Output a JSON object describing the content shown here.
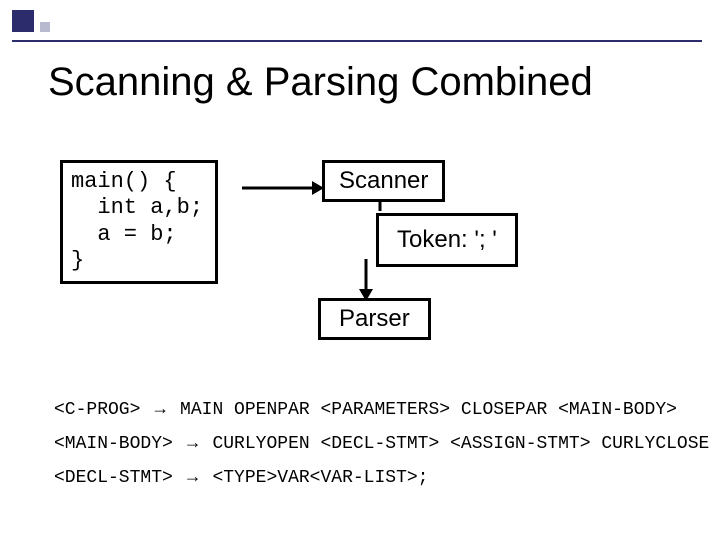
{
  "title": "Scanning & Parsing Combined",
  "code": "main() {\n  int a,b;\n  a = b;\n}",
  "boxes": {
    "scanner": "Scanner",
    "token": "Token: '; '",
    "parser": "Parser"
  },
  "grammar": {
    "line1": {
      "lhs": "<C-PROG>",
      "rhs": "MAIN OPENPAR <PARAMETERS> CLOSEPAR <MAIN-BODY>"
    },
    "line2": {
      "lhs": "<MAIN-BODY>",
      "rhs": "CURLYOPEN <DECL-STMT> <ASSIGN-STMT> CURLYCLOSE"
    },
    "line3": {
      "lhs": "<DECL-STMT>",
      "rhs": "<TYPE>VAR<VAR-LIST>;"
    }
  },
  "arrow_symbol": "→"
}
